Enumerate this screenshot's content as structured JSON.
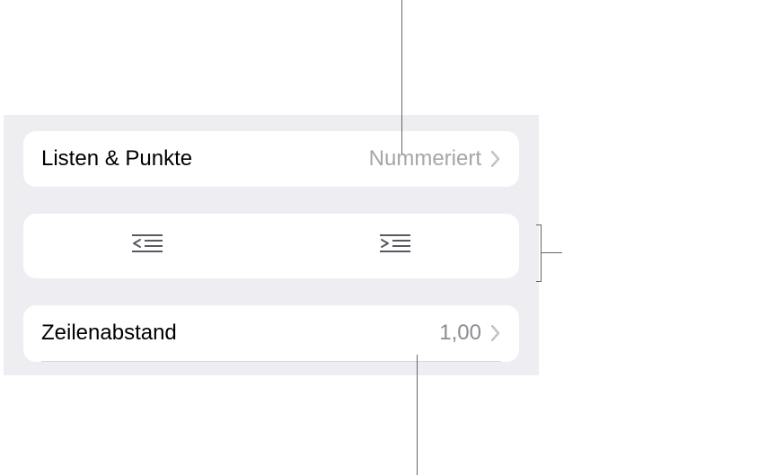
{
  "listsBullets": {
    "label": "Listen & Punkte",
    "value": "Nummeriert"
  },
  "indent": {
    "outdent_icon": "indent-decrease-icon",
    "indent_icon": "indent-increase-icon"
  },
  "lineSpacing": {
    "label": "Zeilenabstand",
    "value": "1,00"
  }
}
